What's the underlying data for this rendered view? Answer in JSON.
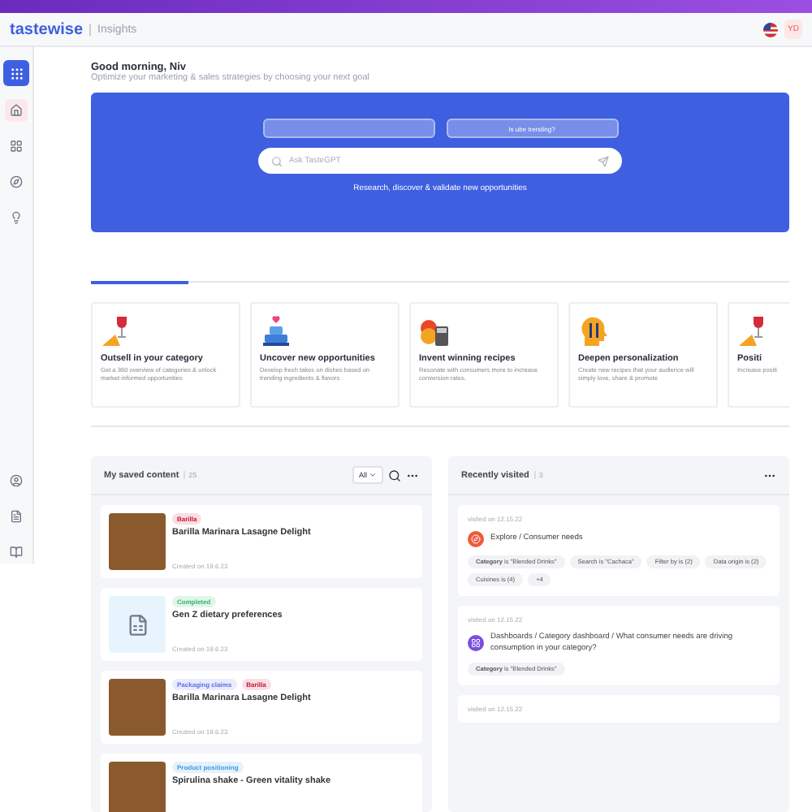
{
  "header": {
    "brand": "tastewise",
    "section": "Insights",
    "avatar": "YD"
  },
  "sidebar": {
    "top": [
      {
        "selected": true
      },
      {
        "selected": false
      },
      {
        "selected": false
      },
      {
        "selected": false
      }
    ]
  },
  "greeting": {
    "title": "Good morning, Niv",
    "subtitle": "Optimize your marketing & sales strategies by choosing your next goal"
  },
  "hero": {
    "suggestions": [
      {
        "kind": "blank"
      },
      {
        "kind": "text",
        "label": "Is ube trending?"
      }
    ],
    "search": {
      "placeholder": "Ask TasteGPT"
    },
    "caption": "Research, discover & validate new opportunities"
  },
  "progress": {
    "level": 0.14
  },
  "goals": [
    {
      "title": "Outsell in your category",
      "text": "Get a 360 overview of categories & unlock market-informed opportunities"
    },
    {
      "title": "Uncover new opportunities",
      "text": "Develop fresh takes on dishes based on trending ingredients & flavors"
    },
    {
      "title": "Invent winning recipes",
      "text": "Resonate with consumers more to increase conversion rates."
    },
    {
      "title": "Deepen personalization",
      "text": "Create new recipes that your audience will simply love, share & promote"
    },
    {
      "title": "Positi",
      "text": "Increase positi"
    }
  ],
  "saved": {
    "title": "My saved content",
    "count": "25",
    "filter": "All",
    "items": [
      {
        "kind": "photo",
        "badges": [
          {
            "label": "Barilla",
            "color": "#c8102e"
          }
        ],
        "title": "Barilla Marinara Lasagne Delight",
        "date": "Created on 19.6.23"
      },
      {
        "kind": "document",
        "badges": [
          {
            "label": "Completed",
            "color": "#2fb36b"
          }
        ],
        "title": "Gen Z dietary preferences",
        "date": "Created on 19.6.23"
      },
      {
        "kind": "photo",
        "badges": [
          {
            "label": "Packaging claims",
            "color": "#5b6ee8"
          },
          {
            "label": "Barilla",
            "color": "#c8102e"
          }
        ],
        "title": "Barilla Marinara Lasagne Delight",
        "date": "Created on 19.6.23"
      },
      {
        "kind": "photo",
        "badges": [
          {
            "label": "Product positioning",
            "color": "#3b9be8"
          }
        ],
        "title": "Spirulina shake - Green vitality shake"
      }
    ]
  },
  "recent": {
    "title": "Recently visited",
    "count": "3",
    "items": [
      {
        "date": "visited on 12.15.22",
        "kind": "explore",
        "color": "#ee5a3c",
        "path": "Explore / Consumer needs",
        "chips": [
          "**Category** is \"Blended Drinks\"",
          "Search is \"Cachaca\"",
          "Filter by is (2)",
          "Data origin is (2)",
          "Cuisines is (4)",
          "+4"
        ]
      },
      {
        "date": "visited on 12.15.22",
        "kind": "dashboard",
        "color": "#7b4fe0",
        "path": "Dashboards / Category dashboard / What consumer needs are driving consumption in your category?",
        "chips": [
          "**Category** is \"Blended Drinks\""
        ]
      },
      {
        "date": "visited on 12.15.22"
      }
    ]
  }
}
